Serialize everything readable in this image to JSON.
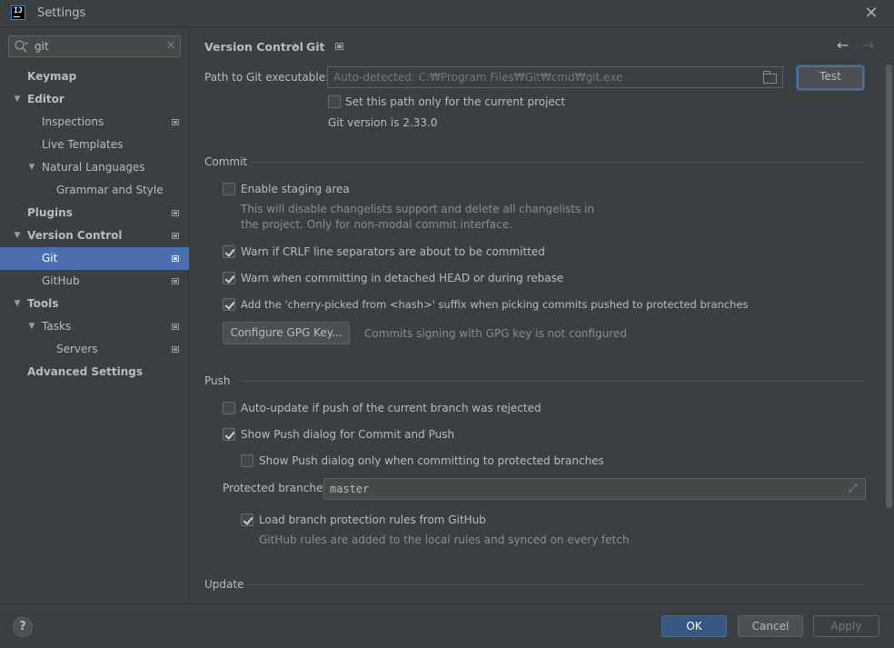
{
  "window": {
    "title": "Settings",
    "app_icon_text": "IJ",
    "close_glyph": "✕"
  },
  "search": {
    "value": "git",
    "clear_glyph": "✕"
  },
  "sidebar": {
    "items": [
      {
        "label": "Keymap"
      },
      {
        "label": "Editor"
      },
      {
        "label": "Inspections"
      },
      {
        "label": "Live Templates"
      },
      {
        "label": "Natural Languages"
      },
      {
        "label": "Grammar and Style"
      },
      {
        "label": "Plugins"
      },
      {
        "label": "Version Control"
      },
      {
        "label": "Git"
      },
      {
        "label": "GitHub"
      },
      {
        "label": "Tools"
      },
      {
        "label": "Tasks"
      },
      {
        "label": "Servers"
      },
      {
        "label": "Advanced Settings"
      }
    ]
  },
  "breadcrumb": {
    "parent": "Version Control",
    "separator": "›",
    "current": "Git"
  },
  "nav": {
    "back": "←",
    "forward": "→"
  },
  "git_path": {
    "label": "Path to Git executable:",
    "placeholder": "Auto-detected: C:₩Program Files₩Git₩cmd₩git.exe",
    "test_button": "Test",
    "current_project_only": {
      "label": "Set this path only for the current project",
      "checked": false
    },
    "version_text": "Git version is 2.33.0"
  },
  "commit": {
    "title": "Commit",
    "staging": {
      "label": "Enable staging area",
      "checked": false,
      "hint_line1": "This will disable changelists support and delete all changelists in",
      "hint_line2": "the project. Only for non-modal commit interface."
    },
    "crlf": {
      "label": "Warn if CRLF line separators are about to be committed",
      "checked": true
    },
    "detached": {
      "label": "Warn when committing in detached HEAD or during rebase",
      "checked": true
    },
    "cherry": {
      "label": "Add the 'cherry-picked from <hash>' suffix when picking commits pushed to protected branches",
      "checked": true
    },
    "gpg_button": "Configure GPG Key...",
    "gpg_status": "Commits signing with GPG key is not configured"
  },
  "push": {
    "title": "Push",
    "auto_update": {
      "label": "Auto-update if push of the current branch was rejected",
      "checked": false
    },
    "show_dialog": {
      "label": "Show Push dialog for Commit and Push",
      "checked": true
    },
    "show_dialog_protected": {
      "label": "Show Push dialog only when committing to protected branches",
      "checked": false
    },
    "protected_label": "Protected branches:",
    "protected_value": "master",
    "load_rules": {
      "label": "Load branch protection rules from GitHub",
      "checked": true
    },
    "load_rules_hint": "GitHub rules are added to the local rules and synced on every fetch"
  },
  "update": {
    "title": "Update"
  },
  "footer": {
    "help": "?",
    "ok": "OK",
    "cancel": "Cancel",
    "apply": "Apply"
  }
}
